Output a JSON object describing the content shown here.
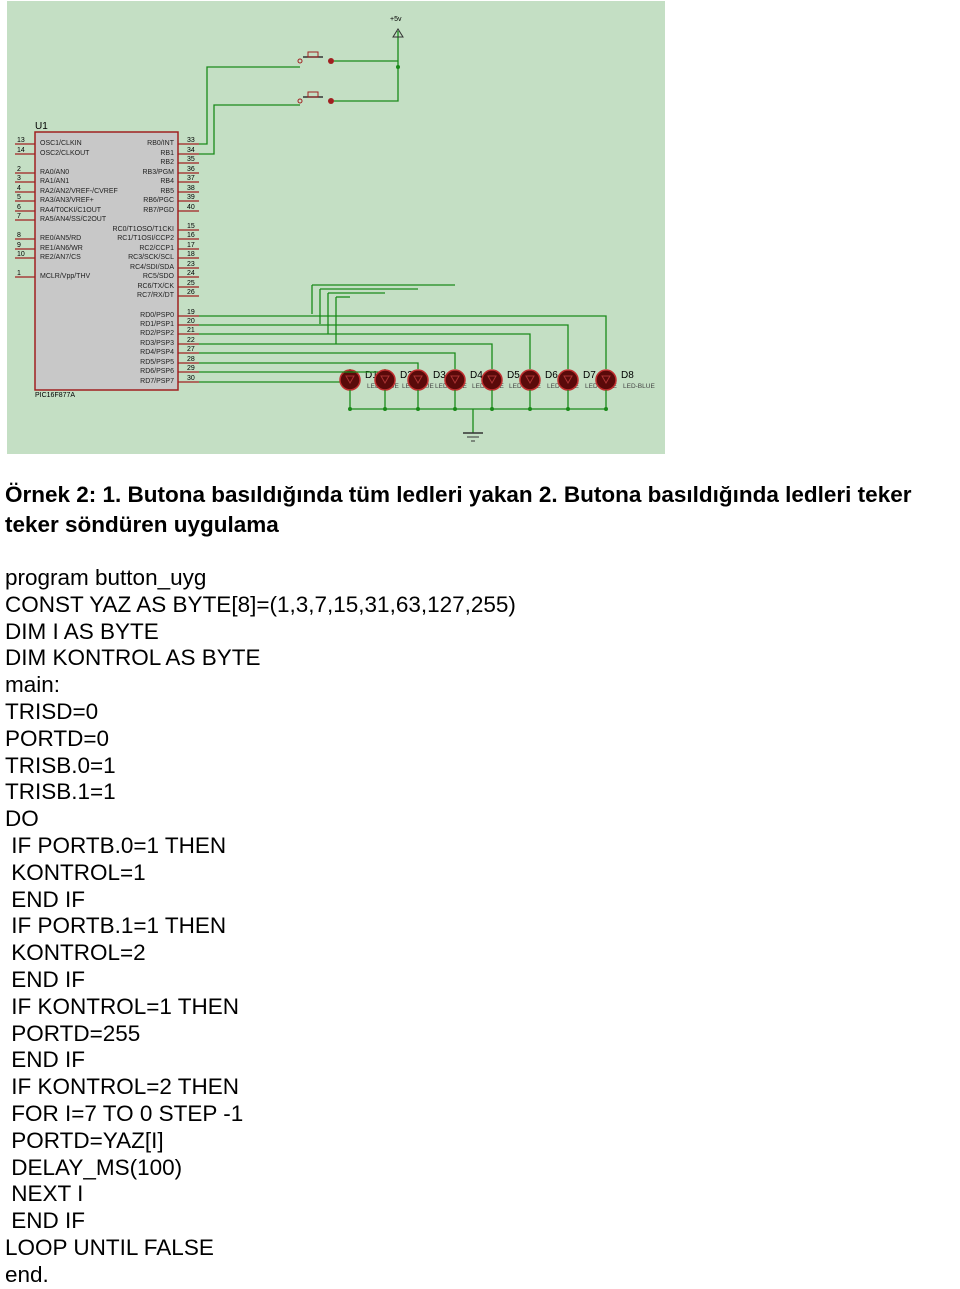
{
  "schematic": {
    "background": "#c4dfc4",
    "chip_ref": "U1",
    "chip_part": "PIC16F877A",
    "power_label": "+5v",
    "left_pins": [
      {
        "num": "13",
        "name": "OSC1/CLKIN"
      },
      {
        "num": "14",
        "name": "OSC2/CLKOUT"
      },
      {
        "num": "2",
        "name": "RA0/AN0"
      },
      {
        "num": "3",
        "name": "RA1/AN1"
      },
      {
        "num": "4",
        "name": "RA2/AN2/VREF-/CVREF"
      },
      {
        "num": "5",
        "name": "RA3/AN3/VREF+"
      },
      {
        "num": "6",
        "name": "RA4/T0CKI/C1OUT"
      },
      {
        "num": "7",
        "name": "RA5/AN4/SS/C2OUT"
      },
      {
        "num": "8",
        "name": "RE0/AN5/RD"
      },
      {
        "num": "9",
        "name": "RE1/AN6/WR"
      },
      {
        "num": "10",
        "name": "RE2/AN7/CS"
      },
      {
        "num": "1",
        "name": "MCLR/Vpp/THV"
      }
    ],
    "right_pins": [
      {
        "num": "33",
        "name": "RB0/INT"
      },
      {
        "num": "34",
        "name": "RB1"
      },
      {
        "num": "35",
        "name": "RB2"
      },
      {
        "num": "36",
        "name": "RB3/PGM"
      },
      {
        "num": "37",
        "name": "RB4"
      },
      {
        "num": "38",
        "name": "RB5"
      },
      {
        "num": "39",
        "name": "RB6/PGC"
      },
      {
        "num": "40",
        "name": "RB7/PGD"
      },
      {
        "num": "15",
        "name": "RC0/T1OSO/T1CKI"
      },
      {
        "num": "16",
        "name": "RC1/T1OSI/CCP2"
      },
      {
        "num": "17",
        "name": "RC2/CCP1"
      },
      {
        "num": "18",
        "name": "RC3/SCK/SCL"
      },
      {
        "num": "23",
        "name": "RC4/SDI/SDA"
      },
      {
        "num": "24",
        "name": "RC5/SDO"
      },
      {
        "num": "25",
        "name": "RC6/TX/CK"
      },
      {
        "num": "26",
        "name": "RC7/RX/DT"
      },
      {
        "num": "19",
        "name": "RD0/PSP0"
      },
      {
        "num": "20",
        "name": "RD1/PSP1"
      },
      {
        "num": "21",
        "name": "RD2/PSP2"
      },
      {
        "num": "22",
        "name": "RD3/PSP3"
      },
      {
        "num": "27",
        "name": "RD4/PSP4"
      },
      {
        "num": "28",
        "name": "RD5/PSP5"
      },
      {
        "num": "29",
        "name": "RD6/PSP6"
      },
      {
        "num": "30",
        "name": "RD7/PSP7"
      }
    ],
    "leds": [
      {
        "ref": "D1",
        "type": "LED-BLUE"
      },
      {
        "ref": "D2",
        "type": "LED-BLUE"
      },
      {
        "ref": "D3",
        "type": "LED-BLUE"
      },
      {
        "ref": "D4",
        "type": "LED-BLUE"
      },
      {
        "ref": "D5",
        "type": "LED-BLUE"
      },
      {
        "ref": "D6",
        "type": "LED-BLUE"
      },
      {
        "ref": "D7",
        "type": "LED-BLUE"
      },
      {
        "ref": "D8",
        "type": "LED-BLUE"
      }
    ]
  },
  "heading": "Örnek 2: 1. Butona basıldığında tüm ledleri yakan 2. Butona basıldığında ledleri teker teker söndüren uygulama",
  "code_lines": [
    "program button_uyg",
    "CONST YAZ AS BYTE[8]=(1,3,7,15,31,63,127,255)",
    "DIM I AS BYTE",
    "DIM KONTROL AS BYTE",
    "main:",
    "TRISD=0",
    "PORTD=0",
    "TRISB.0=1",
    "TRISB.1=1",
    "DO",
    " IF PORTB.0=1 THEN",
    " KONTROL=1",
    " END IF",
    " IF PORTB.1=1 THEN",
    " KONTROL=2",
    " END IF",
    " IF KONTROL=1 THEN",
    " PORTD=255",
    " END IF",
    " IF KONTROL=2 THEN",
    " FOR I=7 TO 0 STEP -1",
    " PORTD=YAZ[I]",
    " DELAY_MS(100)",
    " NEXT I",
    " END IF",
    "LOOP UNTIL FALSE",
    "end."
  ]
}
